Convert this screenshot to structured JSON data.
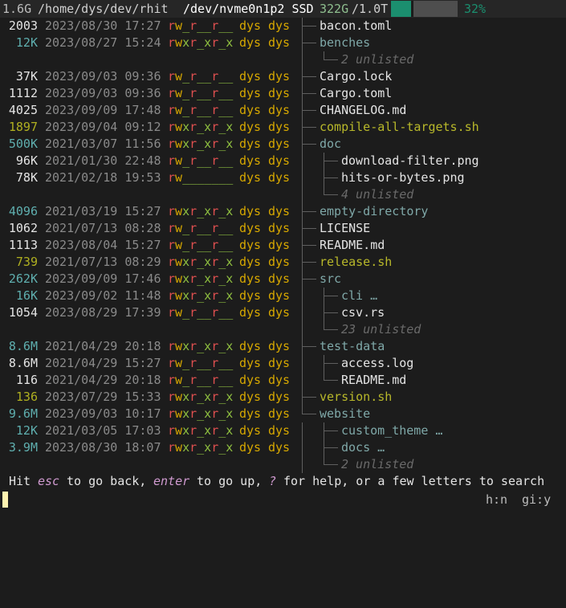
{
  "header": {
    "total_size": "1.6G",
    "path": "/home/dys/dev/rhit",
    "device": "/dev/nvme0n1p2 SSD",
    "used": "322G",
    "capacity": "/1.0T",
    "usage_fraction": 0.32,
    "usage_percent": "32%"
  },
  "entries": [
    {
      "size": "2003",
      "date": "2023/08/30 17:27",
      "perm": "rw_r__r__",
      "owner": "dys",
      "group": "dys",
      "name": "bacon.toml",
      "kind": "file",
      "depth": 1,
      "sz": "w"
    },
    {
      "size": "12K",
      "date": "2023/08/27 15:24",
      "perm": "rwxr_xr_x",
      "owner": "dys",
      "group": "dys",
      "name": "benches",
      "kind": "dir",
      "depth": 1,
      "sz": "t"
    },
    {
      "size": "",
      "date": "",
      "perm": "",
      "owner": "",
      "group": "",
      "name": "2 unlisted",
      "kind": "unl",
      "depth": 2,
      "sz": "w"
    },
    {
      "size": "37K",
      "date": "2023/09/03 09:36",
      "perm": "rw_r__r__",
      "owner": "dys",
      "group": "dys",
      "name": "Cargo.lock",
      "kind": "file",
      "depth": 1,
      "sz": "w"
    },
    {
      "size": "1112",
      "date": "2023/09/03 09:36",
      "perm": "rw_r__r__",
      "owner": "dys",
      "group": "dys",
      "name": "Cargo.toml",
      "kind": "file",
      "depth": 1,
      "sz": "w"
    },
    {
      "size": "4025",
      "date": "2023/09/09 17:48",
      "perm": "rw_r__r__",
      "owner": "dys",
      "group": "dys",
      "name": "CHANGELOG.md",
      "kind": "file",
      "depth": 1,
      "sz": "w"
    },
    {
      "size": "1897",
      "date": "2023/09/04 09:12",
      "perm": "rwxr_xr_x",
      "owner": "dys",
      "group": "dys",
      "name": "compile-all-targets.sh",
      "kind": "exe",
      "depth": 1,
      "sz": "y"
    },
    {
      "size": "500K",
      "date": "2021/03/07 11:56",
      "perm": "rwxr_xr_x",
      "owner": "dys",
      "group": "dys",
      "name": "doc",
      "kind": "dir",
      "depth": 1,
      "sz": "t"
    },
    {
      "size": "96K",
      "date": "2021/01/30 22:48",
      "perm": "rw_r__r__",
      "owner": "dys",
      "group": "dys",
      "name": "download-filter.png",
      "kind": "file",
      "depth": 2,
      "sz": "w"
    },
    {
      "size": "78K",
      "date": "2021/02/18 19:53",
      "perm": "rw_______",
      "owner": "dys",
      "group": "dys",
      "name": "hits-or-bytes.png",
      "kind": "file",
      "depth": 2,
      "sz": "w"
    },
    {
      "size": "",
      "date": "",
      "perm": "",
      "owner": "",
      "group": "",
      "name": "4 unlisted",
      "kind": "unl",
      "depth": 2,
      "sz": "w"
    },
    {
      "size": "4096",
      "date": "2021/03/19 15:27",
      "perm": "rwxr_xr_x",
      "owner": "dys",
      "group": "dys",
      "name": "empty-directory",
      "kind": "dir",
      "depth": 1,
      "sz": "t"
    },
    {
      "size": "1062",
      "date": "2021/07/13 08:28",
      "perm": "rw_r__r__",
      "owner": "dys",
      "group": "dys",
      "name": "LICENSE",
      "kind": "file",
      "depth": 1,
      "sz": "w"
    },
    {
      "size": "1113",
      "date": "2023/08/04 15:27",
      "perm": "rw_r__r__",
      "owner": "dys",
      "group": "dys",
      "name": "README.md",
      "kind": "file",
      "depth": 1,
      "sz": "w"
    },
    {
      "size": "739",
      "date": "2021/07/13 08:29",
      "perm": "rwxr_xr_x",
      "owner": "dys",
      "group": "dys",
      "name": "release.sh",
      "kind": "exe",
      "depth": 1,
      "sz": "y"
    },
    {
      "size": "262K",
      "date": "2023/09/09 17:46",
      "perm": "rwxr_xr_x",
      "owner": "dys",
      "group": "dys",
      "name": "src",
      "kind": "dir",
      "depth": 1,
      "sz": "t"
    },
    {
      "size": "16K",
      "date": "2023/09/02 11:48",
      "perm": "rwxr_xr_x",
      "owner": "dys",
      "group": "dys",
      "name": "cli …",
      "kind": "dir",
      "depth": 2,
      "sz": "t"
    },
    {
      "size": "1054",
      "date": "2023/08/29 17:39",
      "perm": "rw_r__r__",
      "owner": "dys",
      "group": "dys",
      "name": "csv.rs",
      "kind": "file",
      "depth": 2,
      "sz": "w"
    },
    {
      "size": "",
      "date": "",
      "perm": "",
      "owner": "",
      "group": "",
      "name": "23 unlisted",
      "kind": "unl",
      "depth": 2,
      "sz": "w"
    },
    {
      "size": "8.6M",
      "date": "2021/04/29 20:18",
      "perm": "rwxr_xr_x",
      "owner": "dys",
      "group": "dys",
      "name": "test-data",
      "kind": "dir",
      "depth": 1,
      "sz": "t"
    },
    {
      "size": "8.6M",
      "date": "2021/04/29 15:27",
      "perm": "rw_r__r__",
      "owner": "dys",
      "group": "dys",
      "name": "access.log",
      "kind": "file",
      "depth": 2,
      "sz": "w"
    },
    {
      "size": "116",
      "date": "2021/04/29 20:18",
      "perm": "rw_r__r__",
      "owner": "dys",
      "group": "dys",
      "name": "README.md",
      "kind": "file",
      "depth": 2,
      "sz": "w"
    },
    {
      "size": "136",
      "date": "2023/07/29 15:33",
      "perm": "rwxr_xr_x",
      "owner": "dys",
      "group": "dys",
      "name": "version.sh",
      "kind": "exe",
      "depth": 1,
      "sz": "y"
    },
    {
      "size": "9.6M",
      "date": "2023/09/03 10:17",
      "perm": "rwxr_xr_x",
      "owner": "dys",
      "group": "dys",
      "name": "website",
      "kind": "dir",
      "depth": 1,
      "sz": "t"
    },
    {
      "size": "12K",
      "date": "2021/03/05 17:03",
      "perm": "rwxr_xr_x",
      "owner": "dys",
      "group": "dys",
      "name": "custom_theme …",
      "kind": "dir",
      "depth": 2,
      "sz": "t"
    },
    {
      "size": "3.9M",
      "date": "2023/08/30 18:07",
      "perm": "rwxr_xr_x",
      "owner": "dys",
      "group": "dys",
      "name": "docs …",
      "kind": "dir",
      "depth": 2,
      "sz": "t"
    },
    {
      "size": "",
      "date": "",
      "perm": "",
      "owner": "",
      "group": "",
      "name": "2 unlisted",
      "kind": "unl",
      "depth": 2,
      "sz": "w"
    }
  ],
  "status": {
    "hit": "Hit",
    "esc_key": "esc",
    "esc_text": "to go back,",
    "enter_key": "enter",
    "enter_text": "to go up,",
    "help_key": "?",
    "help_text": "for help, or a few letters to search"
  },
  "input": {
    "hint_hidden": "h:n",
    "hint_gitignore": "gi:y"
  }
}
